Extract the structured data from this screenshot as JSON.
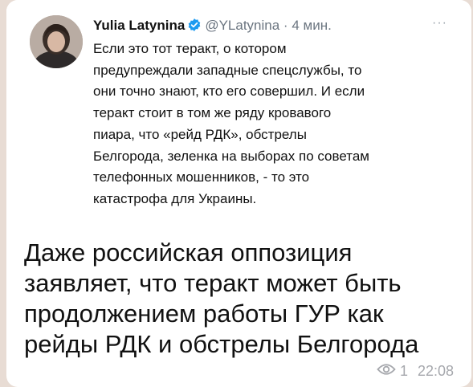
{
  "tweet": {
    "author": "Yulia Latynina",
    "handle": "@YLatynina",
    "separator": "·",
    "time": "4 мин.",
    "more": "···",
    "lines": [
      "Если это тот теракт, о котором",
      "предупреждали западные спецслужбы, то",
      "они точно знают, кто его совершил. И если",
      "теракт стоит в том же ряду кровавого",
      "пиара, что «рейд РДК», обстрелы",
      "Белгорода, зеленка на выборах по советам",
      "телефонных мошенников, - то это",
      "катастрофа для Украины."
    ]
  },
  "message": {
    "lines": [
      "Даже российская оппозиция",
      "заявляет, что теракт может быть",
      "продолжением работы ГУР как",
      "рейды РДК и обстрелы Белгорода"
    ]
  },
  "meta": {
    "views": "1",
    "time": "22:08",
    "icon": "eye-icon"
  },
  "colors": {
    "verified": "#1d9bf0",
    "meta": "#a6a8ad",
    "text": "#111111"
  }
}
